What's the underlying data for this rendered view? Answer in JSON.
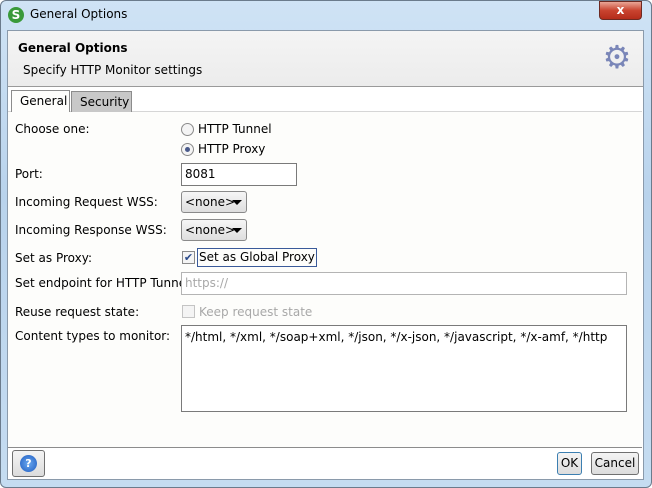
{
  "window": {
    "title": "General Options",
    "close_label": "x"
  },
  "header": {
    "title": "General Options",
    "subtitle": "Specify HTTP Monitor settings"
  },
  "tabs": [
    {
      "label": "General",
      "active": true
    },
    {
      "label": "Security",
      "active": false
    }
  ],
  "form": {
    "choose_one_label": "Choose one:",
    "radio_tunnel": "HTTP Tunnel",
    "radio_proxy": "HTTP Proxy",
    "selected_mode": "HTTP Proxy",
    "port_label": "Port:",
    "port_value": "8081",
    "incoming_request_label": "Incoming Request WSS:",
    "incoming_request_value": "<none>",
    "incoming_response_label": "Incoming Response WSS:",
    "incoming_response_value": "<none>",
    "set_proxy_label": "Set as Proxy:",
    "global_proxy_label": "Set as Global Proxy",
    "global_proxy_checked": true,
    "endpoint_label": "Set endpoint for HTTP Tunnel:",
    "endpoint_placeholder": "https://",
    "reuse_label": "Reuse request state:",
    "keep_state_label": "Keep request state",
    "keep_state_checked": false,
    "content_types_label": "Content types to monitor:",
    "content_types_value": "*/html, */xml, */soap+xml, */json, */x-json, */javascript, */x-amf, */http"
  },
  "footer": {
    "help_icon": "?",
    "ok_label": "OK",
    "cancel_label": "Cancel"
  }
}
